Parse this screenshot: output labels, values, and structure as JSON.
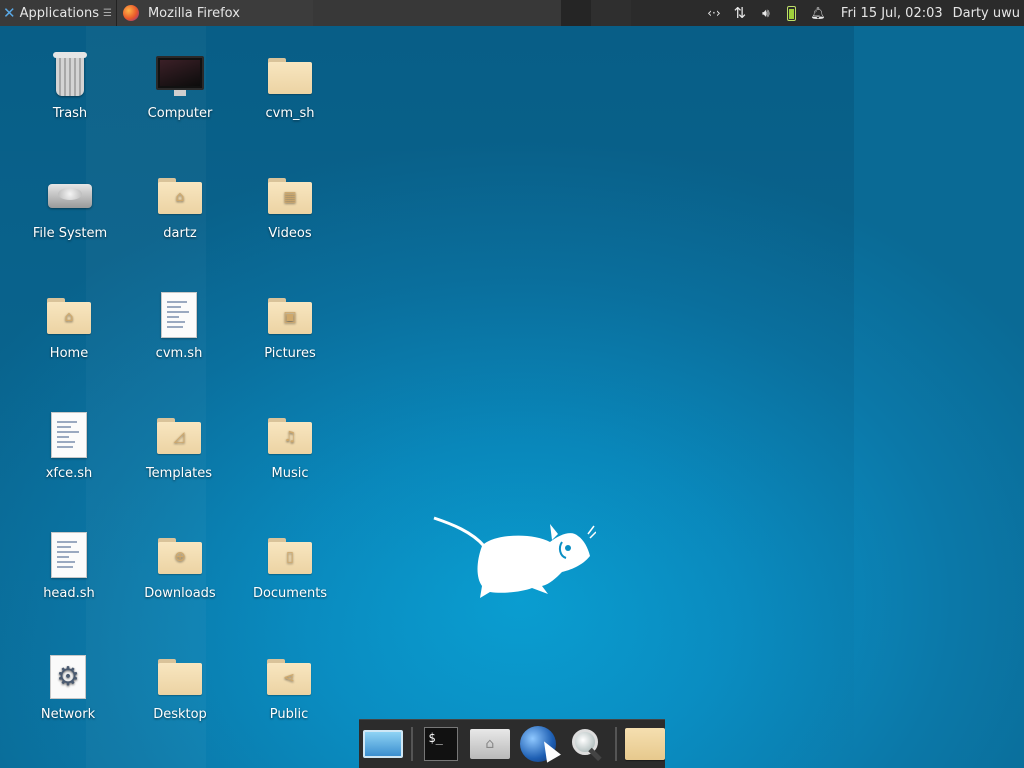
{
  "panel": {
    "applications_label": "Applications",
    "task_title": "Mozilla Firefox",
    "clock": "Fri 15 Jul, 02:03",
    "user": "Darty uwu",
    "tray_icons": [
      "network-arrows-icon",
      "transfer-icon",
      "volume-icon",
      "battery-icon",
      "bell-icon"
    ]
  },
  "desktop": {
    "icons": [
      {
        "label": "Trash",
        "icon": "trash-icon"
      },
      {
        "label": "Computer",
        "icon": "computer-icon"
      },
      {
        "label": "cvm_sh",
        "icon": "folder-icon"
      },
      {
        "label": "File System",
        "icon": "drive-icon"
      },
      {
        "label": "dartz",
        "icon": "home-folder-icon"
      },
      {
        "label": "Videos",
        "icon": "video-folder-icon"
      },
      {
        "label": "Home",
        "icon": "home-folder-icon"
      },
      {
        "label": "cvm.sh",
        "icon": "script-file-icon"
      },
      {
        "label": "Pictures",
        "icon": "pictures-folder-icon"
      },
      {
        "label": "xfce.sh",
        "icon": "script-file-icon"
      },
      {
        "label": "Templates",
        "icon": "templates-folder-icon"
      },
      {
        "label": "Music",
        "icon": "music-folder-icon"
      },
      {
        "label": "head.sh",
        "icon": "script-file-icon"
      },
      {
        "label": "Downloads",
        "icon": "downloads-folder-icon"
      },
      {
        "label": "Documents",
        "icon": "documents-folder-icon"
      },
      {
        "label": "Network",
        "icon": "gear-icon"
      },
      {
        "label": "Desktop",
        "icon": "folder-icon"
      },
      {
        "label": "Public",
        "icon": "share-folder-icon"
      }
    ]
  },
  "dock": {
    "items": [
      "show-desktop-icon",
      "terminal-icon",
      "file-manager-icon",
      "web-browser-icon",
      "app-finder-icon",
      "folder-icon"
    ],
    "terminal_text": "$_"
  },
  "colors": {
    "panel": "#2b2b2b",
    "desktop_bg": "#0a8fc4",
    "folder": "#f3dcae"
  }
}
